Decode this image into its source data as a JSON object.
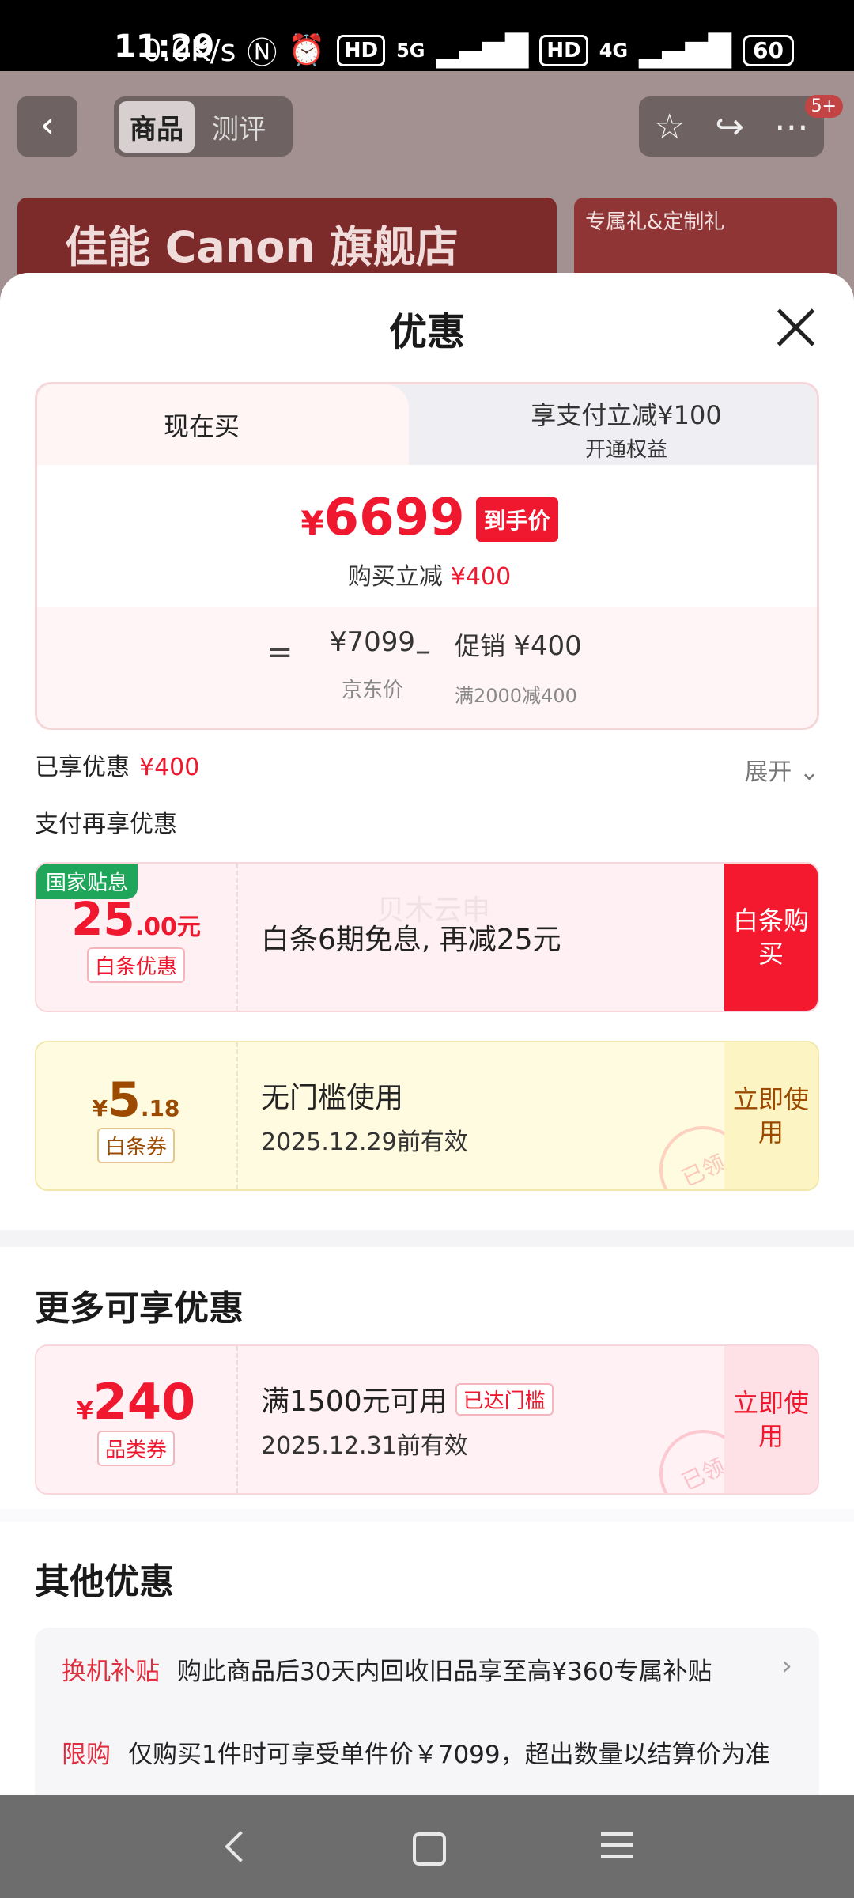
{
  "status_bar": {
    "time": "11:29",
    "net_speed": "0.0K/s",
    "hd1": "HD",
    "signal1": "5G",
    "hd2": "HD",
    "signal2": "4G",
    "battery": "60"
  },
  "background_page": {
    "tabs": [
      "商品",
      "测评"
    ],
    "badge": "5+",
    "banner_text": "佳能 Canon 旗舰店",
    "side_banner_text": "专属礼&定制礼"
  },
  "sheet": {
    "title": "优惠",
    "price_tabs": {
      "active": "现在买",
      "other_line1": "享支付立减¥100",
      "other_line2": "开通权益"
    },
    "final_price": {
      "currency": "¥",
      "value": "6699",
      "tag": "到手价"
    },
    "save": {
      "label": "购买立减",
      "amount": "¥400"
    },
    "breakdown": {
      "eq": "=",
      "jd_price": "¥7099",
      "jd_label": "京东价",
      "minus": "–",
      "promo_label": "促销",
      "promo_amount": "¥400",
      "promo_rule": "满2000减400"
    },
    "enjoyed": {
      "label": "已享优惠",
      "amount": "¥400"
    },
    "expand_label": "展开",
    "pay_more_label": "支付再享优惠",
    "coupon_baitiao": {
      "badge": "国家贴息",
      "amount_int": "25",
      "amount_dec": ".00元",
      "tag": "白条优惠",
      "desc": "白条6期免息, 再减25元",
      "action": "白条购买",
      "watermark": "贝木云申"
    },
    "coupon_ticket": {
      "currency": "¥",
      "amount_int": "5",
      "amount_dec": ".18",
      "tag": "白条券",
      "desc": "无门槛使用",
      "valid": "2025.12.29前有效",
      "action": "立即使用",
      "stamp": "已领"
    },
    "more_title": "更多可享优惠",
    "coupon_category": {
      "currency": "¥",
      "amount": "240",
      "tag": "品类券",
      "desc": "满1500元可用",
      "reached": "已达门槛",
      "valid": "2025.12.31前有效",
      "action": "立即使用",
      "stamp": "已领"
    },
    "other_title": "其他优惠",
    "other_items": [
      {
        "label": "换机补贴",
        "text": "购此商品后30天内回收旧品享至高¥360专属补贴"
      },
      {
        "label": "限购",
        "text": "仅购买1件时可享受单件价￥7099，超出数量以结算价为准"
      }
    ]
  },
  "colors": {
    "accent_red": "#f0182f",
    "national_green": "#1fa65a",
    "ticket_brown": "#9b4a00"
  }
}
